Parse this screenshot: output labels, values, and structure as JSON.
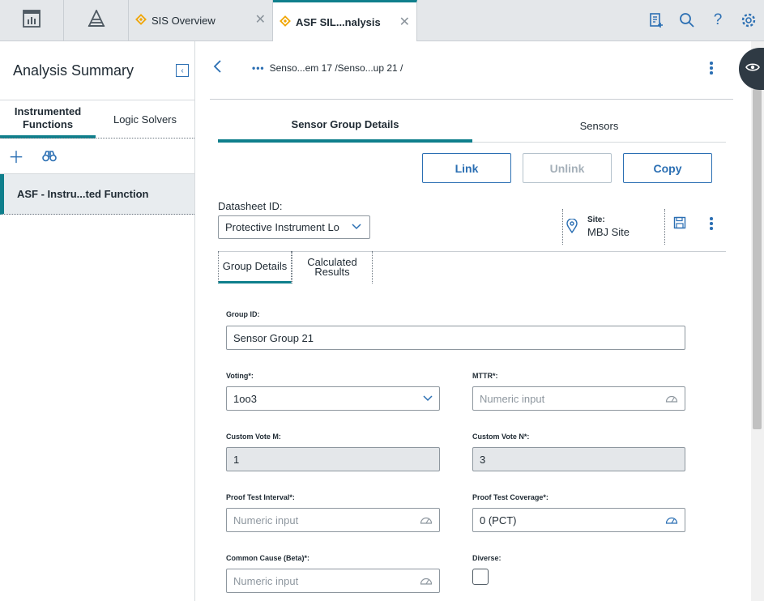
{
  "top_bar": {
    "tabs": [
      {
        "label": "SIS Overview"
      },
      {
        "label": "ASF SIL...nalysis"
      }
    ],
    "icons": [
      "dashboard-icon",
      "pyramid-icon",
      "document-add-icon",
      "search-icon",
      "help-icon",
      "gear-icon"
    ]
  },
  "left_panel": {
    "title": "Analysis Summary",
    "tabs": [
      {
        "label": "Instrumented Functions"
      },
      {
        "label": "Logic Solvers"
      }
    ],
    "list_items": [
      {
        "label": "ASF - Instru...ted Function"
      }
    ]
  },
  "header": {
    "breadcrumb": "Senso...em 17 /Senso...up 21 /"
  },
  "main_tabs": [
    {
      "label": "Sensor Group Details"
    },
    {
      "label": "Sensors"
    }
  ],
  "actions": {
    "link": "Link",
    "unlink": "Unlink",
    "copy": "Copy"
  },
  "datasheet": {
    "label": "Datasheet ID:",
    "value": "Protective Instrument Lo"
  },
  "site": {
    "label": "Site:",
    "value": "MBJ Site"
  },
  "sub_tabs": [
    {
      "label": "Group Details"
    },
    {
      "label": "Calculated Results"
    }
  ],
  "form": {
    "group_id": {
      "label": "Group ID:",
      "value": "Sensor Group 21"
    },
    "voting": {
      "label": "Voting*:",
      "value": "1oo3"
    },
    "mttr": {
      "label": "MTTR*:",
      "placeholder": "Numeric input"
    },
    "custom_vote_m": {
      "label": "Custom Vote M:",
      "value": "1"
    },
    "custom_vote_n": {
      "label": "Custom Vote N*:",
      "value": "3"
    },
    "proof_test_interval": {
      "label": "Proof Test Interval*:",
      "placeholder": "Numeric input"
    },
    "proof_test_coverage": {
      "label": "Proof Test Coverage*:",
      "value": "0 (PCT)"
    },
    "common_cause": {
      "label": "Common Cause (Beta)*:",
      "placeholder": "Numeric input"
    },
    "diverse": {
      "label": "Diverse:",
      "checked": false
    }
  },
  "colors": {
    "accent": "#0f7f8c",
    "link_blue": "#2b6fb3",
    "diamond": "#f0a500"
  }
}
